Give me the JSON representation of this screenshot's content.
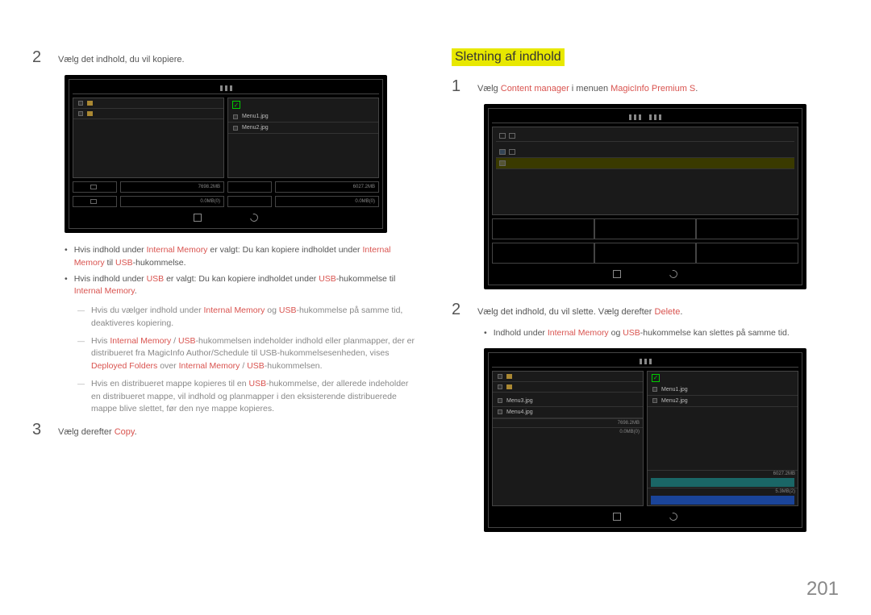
{
  "page_number": "201",
  "left": {
    "step2": "Vælg det indhold, du vil kopiere.",
    "shot1": {
      "items": [
        "Menu1.jpg",
        "Menu2.jpg"
      ],
      "stat1": "7698.2MB",
      "stat2": "6027.2MB",
      "stat3": "0.0MB(0)",
      "stat4": "0.0MB(0)"
    },
    "bullet1_pre": "Hvis indhold under ",
    "bullet1_im": "Internal Memory",
    "bullet1_mid": " er valgt: Du kan kopiere indholdet under ",
    "bullet1_im2": "Internal Memory",
    "bullet1_post": " til ",
    "bullet1_usb": "USB",
    "bullet1_end": "-hukommelse.",
    "bullet2_pre": "Hvis indhold under ",
    "bullet2_usb": "USB",
    "bullet2_mid": " er valgt: Du kan kopiere indholdet under ",
    "bullet2_usb2": "USB",
    "bullet2_post": "-hukommelse til ",
    "bullet2_im": "Internal Memory",
    "bullet2_dot": ".",
    "dash1_pre": "Hvis du vælger indhold under ",
    "dash1_im": "Internal Memory",
    "dash1_og": " og ",
    "dash1_usb": "USB",
    "dash1_post": "-hukommelse på samme tid, deaktiveres kopiering.",
    "dash2_pre": "Hvis ",
    "dash2_im": "Internal Memory",
    "dash2_slash": " / ",
    "dash2_usb": "USB",
    "dash2_mid": "-hukommelsen indeholder indhold eller planmapper, der er distribueret fra MagicInfo Author/Schedule til USB-hukommelsesenheden, vises ",
    "dash2_dep": "Deployed Folders",
    "dash2_over": " over ",
    "dash2_im2": "Internal Memory",
    "dash2_slash2": " / ",
    "dash2_usb2": "USB",
    "dash2_end": "-hukommelsen.",
    "dash3_pre": "Hvis en distribueret mappe kopieres til en ",
    "dash3_usb": "USB",
    "dash3_post": "-hukommelse, der allerede indeholder en distribueret mappe, vil indhold og planmapper i den eksisterende distribuerede mappe blive slettet, før den nye mappe kopieres.",
    "step3_pre": "Vælg derefter ",
    "step3_copy": "Copy",
    "step3_dot": "."
  },
  "right": {
    "title": "Sletning af indhold",
    "step1_pre": "Vælg ",
    "step1_cm": "Content manager",
    "step1_mid": " i menuen ",
    "step1_mips": "MagicInfo Premium S",
    "step1_dot": ".",
    "step2_pre": "Vælg det indhold, du vil slette. Vælg derefter ",
    "step2_del": "Delete",
    "step2_dot": ".",
    "bullet_pre": "Indhold under ",
    "bullet_im": "Internal Memory",
    "bullet_og": " og ",
    "bullet_usb": "USB",
    "bullet_post": "-hukommelse kan slettes på samme tid.",
    "shot2": {
      "left_items": [
        "Menu3.jpg",
        "Menu4.jpg"
      ],
      "right_items": [
        "Menu1.jpg",
        "Menu2.jpg"
      ],
      "ls1": "7698.2MB",
      "ls2": "0.0MB(0)",
      "rs1": "6027.2MB",
      "rs2": "5.3MB(2)"
    }
  }
}
